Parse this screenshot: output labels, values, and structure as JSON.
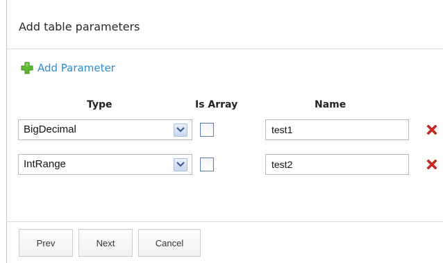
{
  "dialog": {
    "title": "Add table parameters",
    "add_parameter_label": "Add Parameter"
  },
  "columns": {
    "type": "Type",
    "is_array": "Is Array",
    "name": "Name"
  },
  "parameters": [
    {
      "type": "BigDecimal",
      "is_array": false,
      "name": "test1"
    },
    {
      "type": "IntRange",
      "is_array": false,
      "name": "test2"
    }
  ],
  "buttons": {
    "prev": "Prev",
    "next": "Next",
    "cancel": "Cancel"
  },
  "colors": {
    "link": "#2a8fd6",
    "add_icon": "#5cb82e",
    "delete_icon": "#d9261c"
  }
}
